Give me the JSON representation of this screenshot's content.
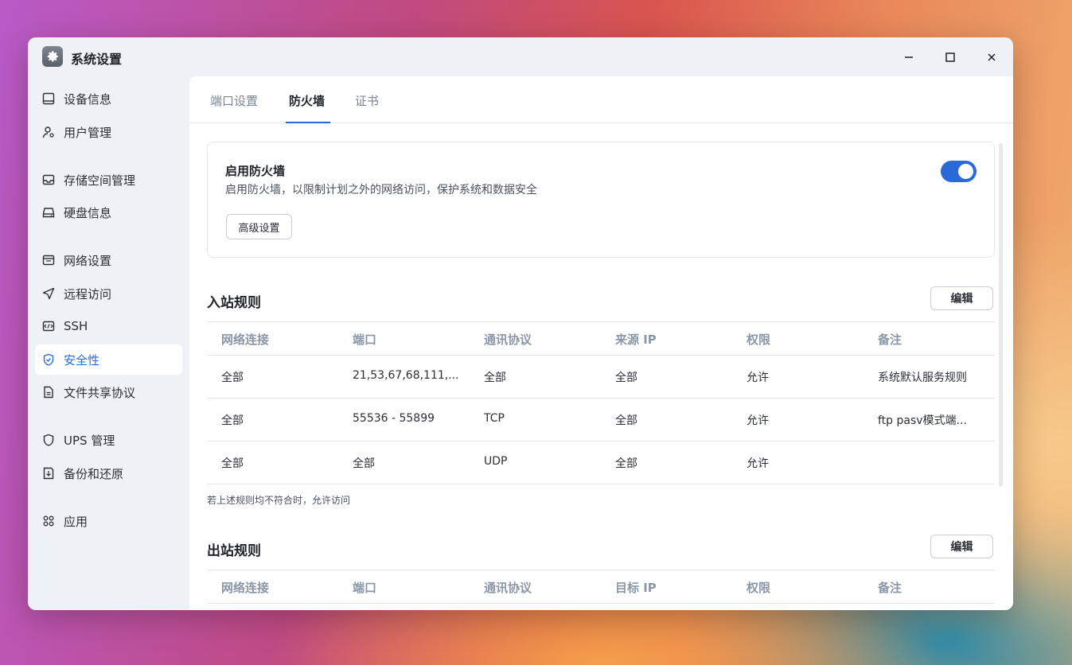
{
  "window": {
    "title": "系统设置",
    "controls": {
      "minimize": "minimize-icon",
      "maximize": "maximize-icon",
      "close": "close-icon"
    }
  },
  "colors": {
    "accent": "#2a6ad8",
    "sidebar_bg": "#eef2f7",
    "header_text": "#8a96a8"
  },
  "sidebar": {
    "items": [
      {
        "label": "设备信息",
        "icon": "device-icon"
      },
      {
        "label": "用户管理",
        "icon": "user-icon"
      },
      {
        "label": "存储空间管理",
        "icon": "storage-icon"
      },
      {
        "label": "硬盘信息",
        "icon": "disk-icon"
      },
      {
        "label": "网络设置",
        "icon": "network-icon"
      },
      {
        "label": "远程访问",
        "icon": "remote-icon"
      },
      {
        "label": "SSH",
        "icon": "terminal-icon"
      },
      {
        "label": "安全性",
        "icon": "shield-icon",
        "active": true
      },
      {
        "label": "文件共享协议",
        "icon": "file-icon"
      },
      {
        "label": "UPS 管理",
        "icon": "ups-icon"
      },
      {
        "label": "备份和还原",
        "icon": "backup-icon"
      },
      {
        "label": "应用",
        "icon": "apps-icon"
      }
    ]
  },
  "tabs": [
    {
      "label": "端口设置"
    },
    {
      "label": "防火墙",
      "active": true
    },
    {
      "label": "证书"
    }
  ],
  "firewall": {
    "title": "启用防火墙",
    "description": "启用防火墙，以限制计划之外的网络访问，保护系统和数据安全",
    "enabled": true,
    "advanced_button": "高级设置"
  },
  "inbound": {
    "title": "入站规则",
    "edit_label": "编辑",
    "headers": [
      "网络连接",
      "端口",
      "通讯协议",
      "来源 IP",
      "权限",
      "备注"
    ],
    "rows": [
      [
        "全部",
        "21,53,67,68,111,...",
        "全部",
        "全部",
        "允许",
        "系统默认服务规则"
      ],
      [
        "全部",
        "55536 - 55899",
        "TCP",
        "全部",
        "允许",
        "ftp pasv模式端..."
      ],
      [
        "全部",
        "全部",
        "UDP",
        "全部",
        "允许",
        ""
      ]
    ],
    "footnote": "若上述规则均不符合时，允许访问"
  },
  "outbound": {
    "title": "出站规则",
    "edit_label": "编辑",
    "headers": [
      "网络连接",
      "端口",
      "通讯协议",
      "目标 IP",
      "权限",
      "备注"
    ]
  }
}
